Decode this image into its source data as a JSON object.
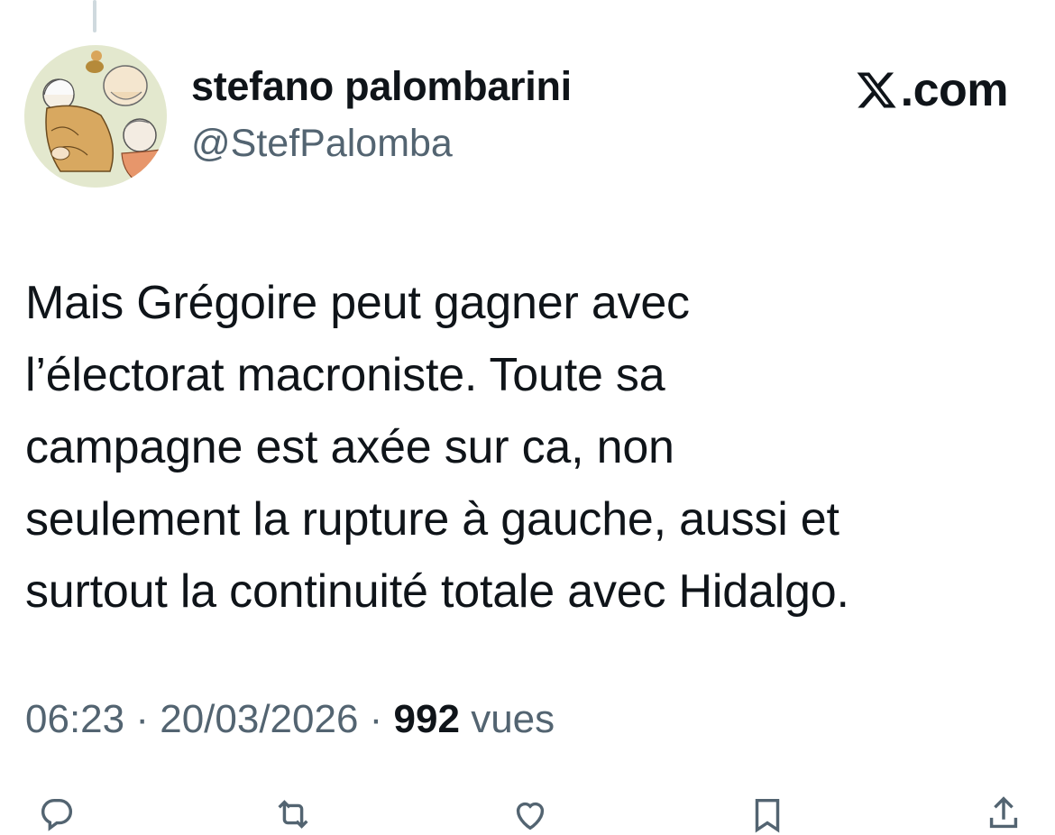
{
  "author": {
    "display_name": "stefano palombarini",
    "handle": "@StefPalomba"
  },
  "brand": {
    "logo_icon": "x-logo-icon",
    "text": ".com"
  },
  "tweet": {
    "text": "Mais Grégoire peut gagner avec\nl’électorat macroniste. Toute sa\ncampagne est axée sur ca, non\nseulement la rupture à gauche, aussi et\nsurtout la continuité totale avec Hidalgo."
  },
  "meta": {
    "time": "06:23",
    "separator": " · ",
    "date": "20/03/2026",
    "views_count": "992",
    "views_label": " vues"
  },
  "actions": {
    "icons": [
      "reply-icon",
      "retweet-icon",
      "like-icon",
      "bookmark-icon",
      "share-icon"
    ]
  },
  "colors": {
    "text_primary": "#0f1419",
    "text_secondary": "#536471",
    "thread_line": "#cfd9de",
    "background": "#ffffff"
  }
}
